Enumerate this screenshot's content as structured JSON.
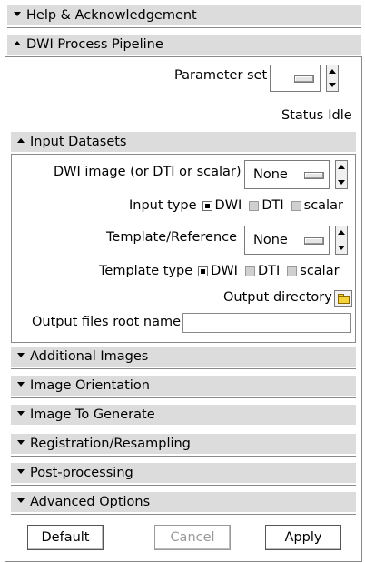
{
  "sections": {
    "help": "Help & Acknowledgement",
    "pipeline": "DWI Process Pipeline",
    "input_datasets": "Input Datasets",
    "additional_images": "Additional Images",
    "image_orientation": "Image Orientation",
    "image_to_generate": "Image To Generate",
    "registration": "Registration/Resampling",
    "post_processing": "Post-processing",
    "advanced_options": "Advanced Options"
  },
  "pipeline": {
    "parameter_set_label": "Parameter set",
    "status_label": "Status",
    "status_value": "Idle"
  },
  "inputs": {
    "dwi_image_label": "DWI image (or DTI or scalar)",
    "dwi_image_value": "None",
    "input_type_label": "Input type",
    "template_label": "Template/Reference",
    "template_value": "None",
    "template_type_label": "Template type",
    "type_options": [
      "DWI",
      "DTI",
      "scalar"
    ],
    "selected_type": "DWI",
    "output_directory_label": "Output directory",
    "output_root_label": "Output files root name",
    "output_root_value": ""
  },
  "buttons": {
    "default": "Default",
    "cancel": "Cancel",
    "apply": "Apply"
  },
  "icons": {
    "collapse": "triangle-up-icon",
    "expand": "triangle-down-icon",
    "folder": "folder-icon"
  }
}
